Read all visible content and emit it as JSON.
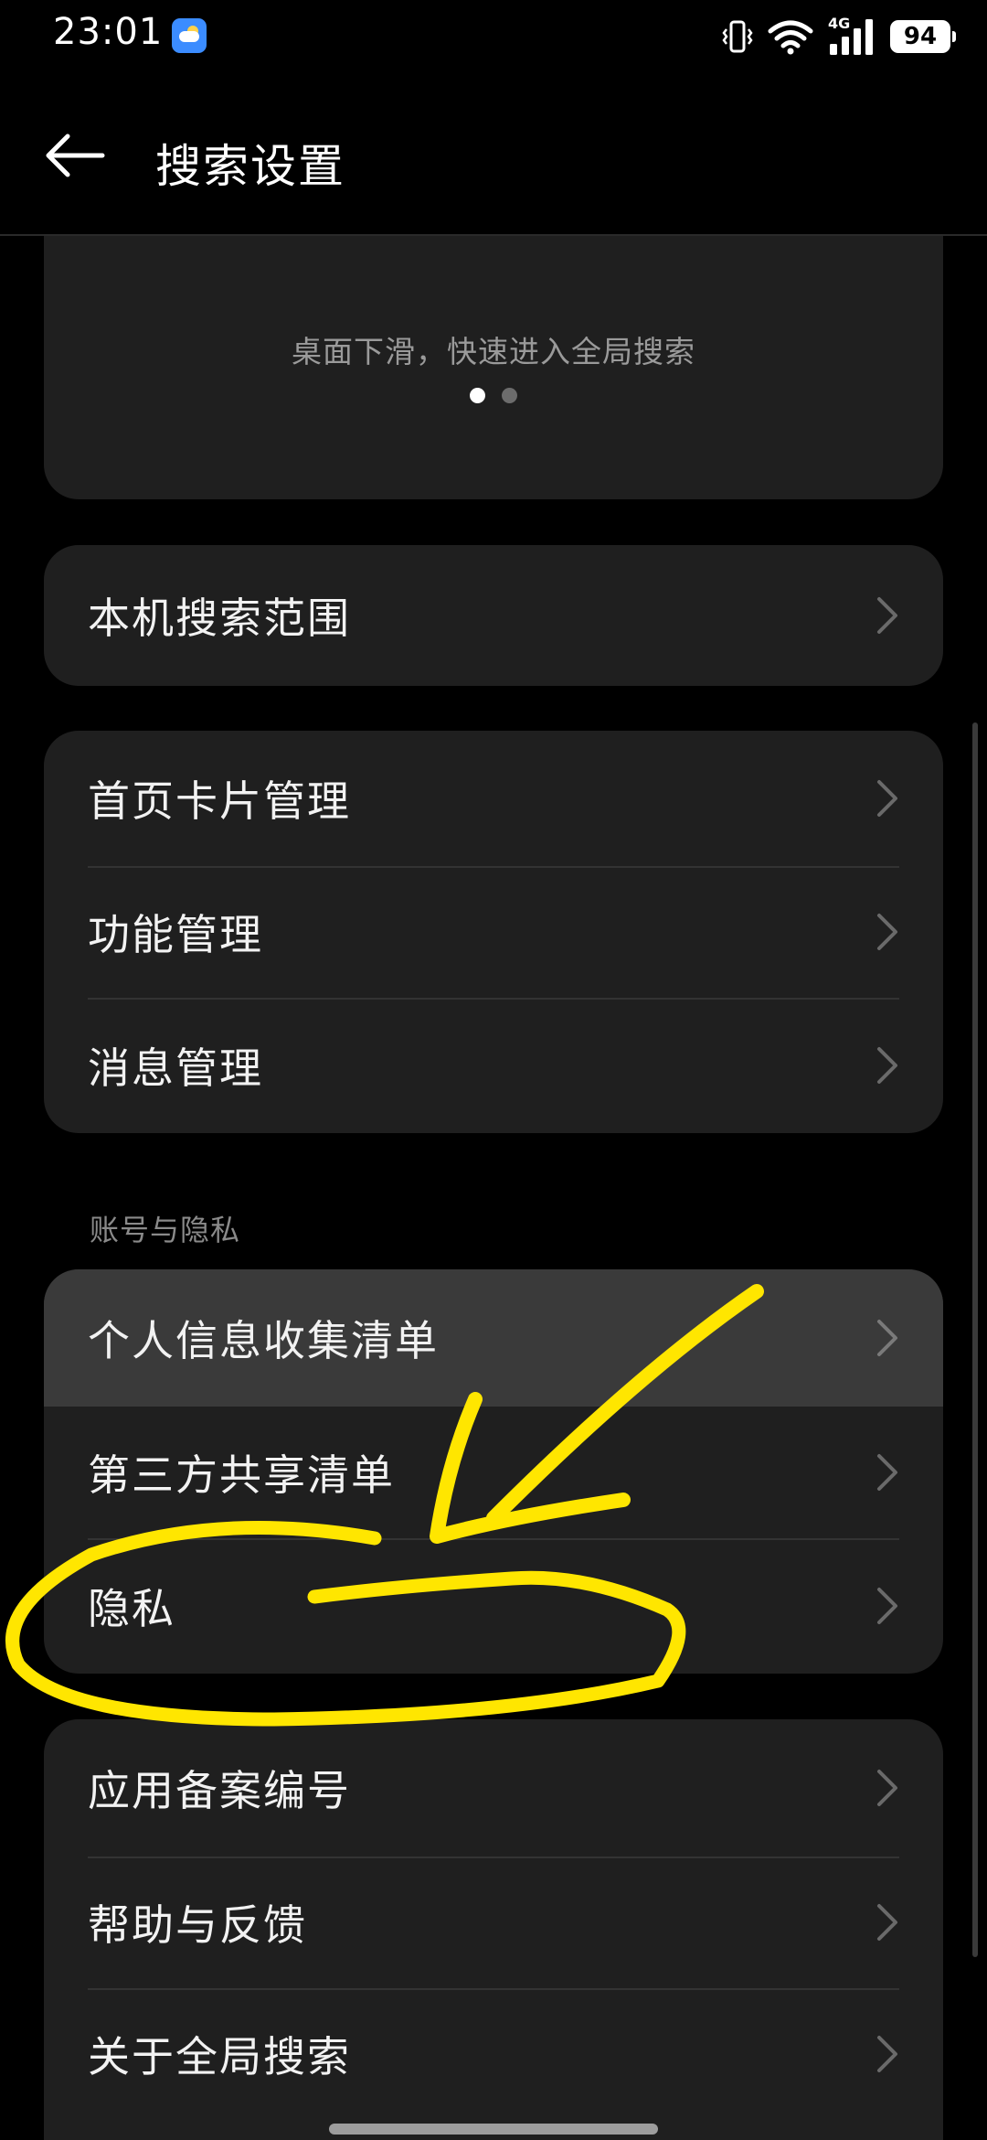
{
  "status_bar": {
    "time": "23:01",
    "network_type": "4G",
    "battery": "94",
    "icons": [
      "weather-icon",
      "vibrate-icon",
      "wifi-icon",
      "signal-icon",
      "battery-icon"
    ]
  },
  "header": {
    "title": "搜索设置",
    "back_icon": "arrow-left-icon"
  },
  "banner": {
    "caption": "桌面下滑，快速进入全局搜索",
    "page_count": 2,
    "active_page": 1
  },
  "groups": [
    {
      "items": [
        {
          "label": "本机搜索范围"
        }
      ]
    },
    {
      "items": [
        {
          "label": "首页卡片管理"
        },
        {
          "label": "功能管理"
        },
        {
          "label": "消息管理"
        }
      ]
    },
    {
      "header": "账号与隐私",
      "items": [
        {
          "label": "个人信息收集清单",
          "pressed": true
        },
        {
          "label": "第三方共享清单"
        },
        {
          "label": "隐私"
        }
      ]
    },
    {
      "items": [
        {
          "label": "应用备案编号"
        },
        {
          "label": "帮助与反馈"
        },
        {
          "label": "关于全局搜索"
        }
      ]
    }
  ],
  "colors": {
    "background": "#000000",
    "card": "#1f1f1f",
    "pressed_row": "#3a3a3a",
    "annotation": "#ffe600"
  }
}
